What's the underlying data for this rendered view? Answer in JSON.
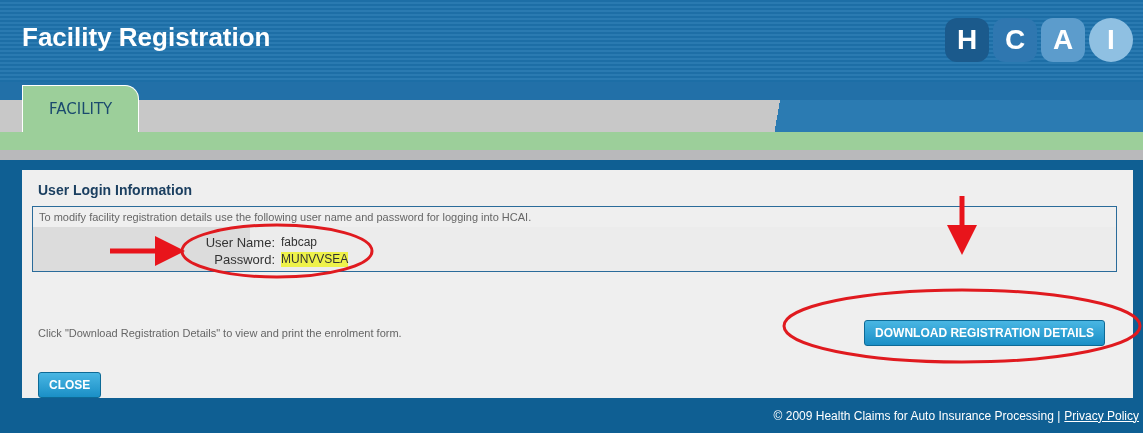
{
  "header": {
    "title": "Facility Registration",
    "logo": [
      "H",
      "C",
      "A",
      "I"
    ]
  },
  "tabs": [
    {
      "label": "FACILITY",
      "selected": true
    }
  ],
  "section": {
    "title": "User Login Information",
    "intro": "To modify facility registration details use the following user name and password for logging into HCAI.",
    "fields": [
      {
        "label": "User Name:",
        "value": "fabcap",
        "highlighted": false
      },
      {
        "label": "Password:",
        "value": "MUNVVSEA",
        "highlighted": true
      }
    ]
  },
  "download": {
    "text": "Click \"Download Registration Details\" to view and print the enrolment form.",
    "button": "DOWNLOAD REGISTRATION DETAILS"
  },
  "close_button": "CLOSE",
  "footer": {
    "copyright": "© 2009 Health Claims for Auto Insurance Processing |",
    "link": "Privacy Policy"
  }
}
